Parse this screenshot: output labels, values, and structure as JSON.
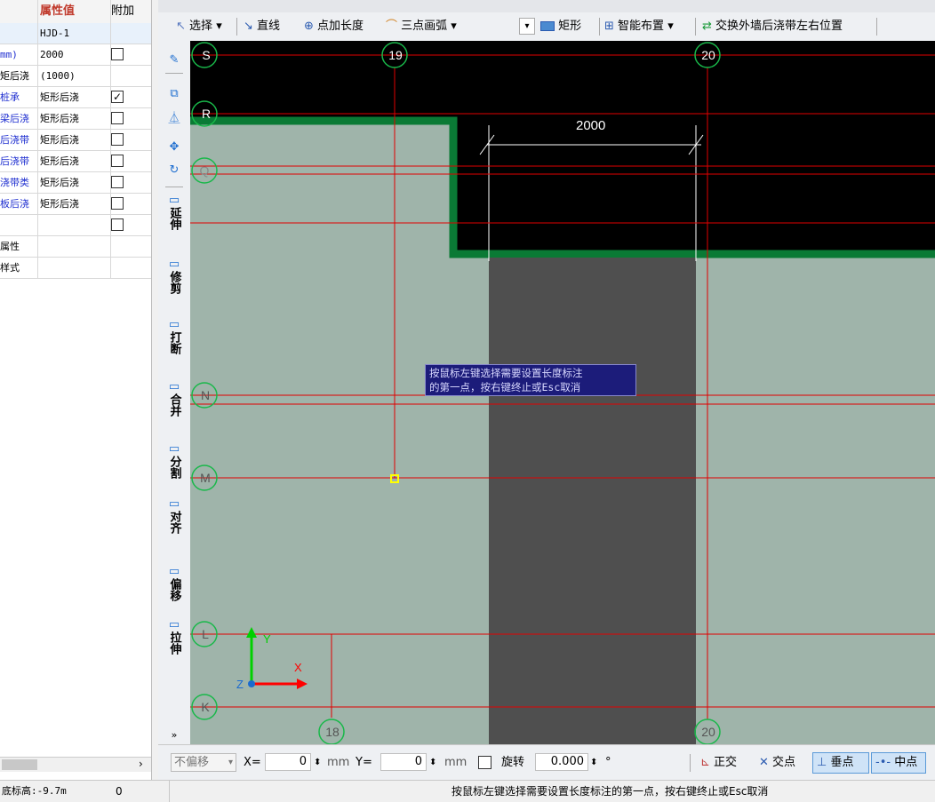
{
  "property_panel": {
    "headers": {
      "value": "属性值",
      "attach": "附加"
    },
    "rows": [
      {
        "name": "",
        "value": "HJD-1",
        "name_color": "blue",
        "checkbox": null
      },
      {
        "name": "mm)",
        "value": "2000",
        "name_color": "blue",
        "checkbox": false
      },
      {
        "name": "矩后浇",
        "value": "(1000)",
        "name_color": "black",
        "checkbox": null
      },
      {
        "name": "桩承",
        "value": "矩形后浇",
        "name_color": "blue",
        "checkbox": true
      },
      {
        "name": "梁后浇",
        "value": "矩形后浇",
        "name_color": "blue",
        "checkbox": false
      },
      {
        "name": "后浇带",
        "value": "矩形后浇",
        "name_color": "blue",
        "checkbox": false
      },
      {
        "name": "后浇带",
        "value": "矩形后浇",
        "name_color": "blue",
        "checkbox": false
      },
      {
        "name": "浇带类",
        "value": "矩形后浇",
        "name_color": "blue",
        "checkbox": false
      },
      {
        "name": "板后浇",
        "value": "矩形后浇",
        "name_color": "blue",
        "checkbox": false
      },
      {
        "name": "",
        "value": "",
        "name_color": "black",
        "checkbox": false
      },
      {
        "name": "属性",
        "value": "",
        "name_color": "black",
        "checkbox": null
      },
      {
        "name": "样式",
        "value": "",
        "name_color": "black",
        "checkbox": null
      }
    ]
  },
  "toolbar": {
    "select": "选择",
    "line": "直线",
    "point_length": "点加长度",
    "three_point_arc": "三点画弧",
    "rect": "矩形",
    "smart_layout": "智能布置",
    "swap_wall": "交换外墙后浇带左右位置"
  },
  "vertical_tools": [
    {
      "icon": "extend-icon",
      "label": "延伸"
    },
    {
      "icon": "trim-icon",
      "label": "修剪"
    },
    {
      "icon": "break-icon",
      "label": "打断"
    },
    {
      "icon": "merge-icon",
      "label": "合并"
    },
    {
      "icon": "split-icon",
      "label": "分割"
    },
    {
      "icon": "align-icon",
      "label": "对齐"
    },
    {
      "icon": "offset-icon",
      "label": "偏移"
    },
    {
      "icon": "stretch-icon",
      "label": "拉伸"
    }
  ],
  "canvas": {
    "axis_labels": {
      "S": "S",
      "R": "R",
      "Q": "Q",
      "N": "N",
      "M": "M",
      "L": "L",
      "K": "K",
      "c19": "19",
      "c20": "20",
      "c18": "18",
      "c20b": "20"
    },
    "dimension_text": "2000",
    "tooltip_line1": "按鼠标左键选择需要设置长度标注",
    "tooltip_line2": "的第一点，按右键终止或Esc取消",
    "ucs": {
      "x": "X",
      "y": "Y",
      "z": "Z"
    }
  },
  "bottombar": {
    "no_offset": "不偏移",
    "x_label": "X=",
    "x_value": "0",
    "y_label": "Y=",
    "y_value": "0",
    "unit": "mm",
    "rotate_label": "旋转",
    "rotate_value": "0.000",
    "degree": "°",
    "ortho": "正交",
    "intersection": "交点",
    "perpendicular": "垂点",
    "midpoint": "中点"
  },
  "status": {
    "base_elevation": "底标高:-9.7m",
    "count": "0",
    "hint": "按鼠标左键选择需要设置长度标注的第一点，按右键终止或Esc取消"
  },
  "colors": {
    "canvas_bg": "#9fb4aa",
    "black_region": "#000000",
    "gray_band": "#4f4f4f",
    "green_border": "#0a7a35",
    "axis_red": "#e00000",
    "axis_circle": "#19b84a",
    "tooltip_bg": "#1c1c7a"
  }
}
